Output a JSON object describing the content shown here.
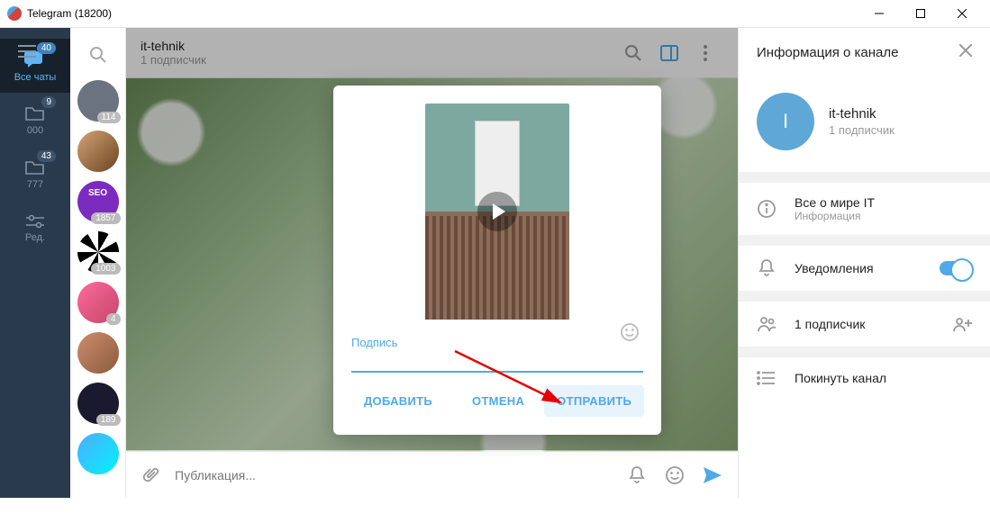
{
  "window": {
    "title": "Telegram (18200)"
  },
  "nav": {
    "items": [
      {
        "label": "Все чаты",
        "badge": "40"
      },
      {
        "label": "000",
        "badge": "9"
      },
      {
        "label": "777",
        "badge": "43"
      },
      {
        "label": "Ред.",
        "badge": ""
      }
    ]
  },
  "chatlist": {
    "items": [
      {
        "badge": "114"
      },
      {
        "badge": ""
      },
      {
        "badge": "1857"
      },
      {
        "badge": "1003"
      },
      {
        "badge": "4"
      },
      {
        "badge": ""
      },
      {
        "badge": "189"
      },
      {
        "badge": ""
      }
    ]
  },
  "chat": {
    "name": "it-tehnik",
    "subscribers": "1 подписчик",
    "input_placeholder": "Публикация..."
  },
  "modal": {
    "caption_label": "Подпись",
    "add": "ДОБАВИТЬ",
    "cancel": "ОТМЕНА",
    "send": "ОТПРАВИТЬ"
  },
  "side": {
    "title": "Информация о канале",
    "channel_name": "it-tehnik",
    "channel_sub": "1 подписчик",
    "avatar_letter": "I",
    "info_title": "Все о мире IT",
    "info_sub": "Информация",
    "notifications": "Уведомления",
    "members": "1 подписчик",
    "leave": "Покинуть канал"
  }
}
